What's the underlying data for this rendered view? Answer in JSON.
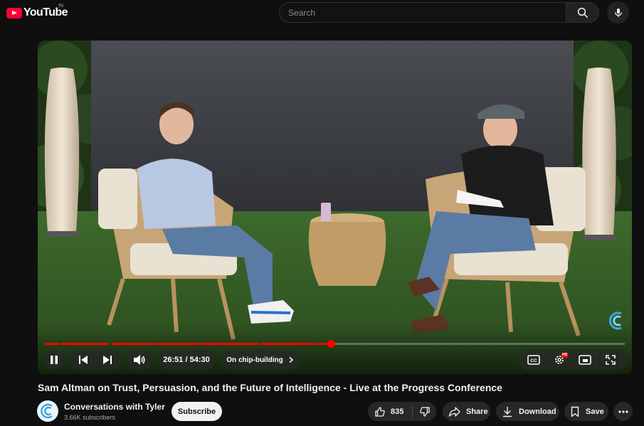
{
  "header": {
    "logo_text": "YouTube",
    "country_code": "IN",
    "search_placeholder": "Search"
  },
  "player": {
    "time_display": "26:51 / 54:30",
    "chapter_label": "On chip-building",
    "progress_fraction": 0.4927,
    "watermark": "channel-logo-icon"
  },
  "video": {
    "title": "Sam Altman on Trust, Persuasion, and the Future of Intelligence - Live at the Progress Conference"
  },
  "channel": {
    "name": "Conversations with Tyler",
    "subscribers": "3.66K subscribers",
    "subscribe_label": "Subscribe"
  },
  "actions": {
    "like_count": "835",
    "share_label": "Share",
    "download_label": "Download",
    "save_label": "Save"
  },
  "colors": {
    "accent": "#ff0000",
    "background": "#0f0f0f",
    "button_bg": "#272727"
  }
}
